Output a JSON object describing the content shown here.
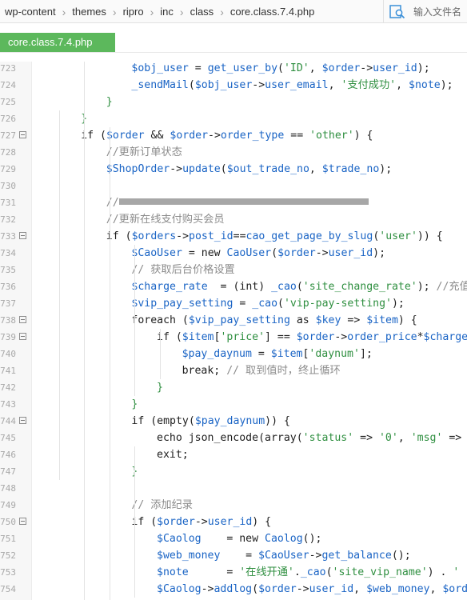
{
  "breadcrumb": [
    "wp-content",
    "themes",
    "ripro",
    "inc",
    "class",
    "core.class.7.4.php"
  ],
  "goto_file": {
    "placeholder": "输入文件名"
  },
  "tab": {
    "label": "core.class.7.4.php"
  },
  "colors": {
    "accent_tab": "#5cb85c",
    "variable": "#1a64c5",
    "function": "#1a64c5",
    "string": "#2f8f40",
    "comment": "#8c8c8c",
    "keyword": "#1e1e1e"
  },
  "code_lines": [
    {
      "num": "723",
      "indent": 4,
      "fold": false,
      "tokens": [
        [
          "v",
          "$obj_user"
        ],
        [
          "p",
          " = "
        ],
        [
          "f",
          "get_user_by"
        ],
        [
          "p",
          "("
        ],
        [
          "s",
          "'ID'"
        ],
        [
          "p",
          ", "
        ],
        [
          "v",
          "$order"
        ],
        [
          "p",
          "->"
        ],
        [
          "f",
          "user_id"
        ],
        [
          "p",
          ");"
        ]
      ]
    },
    {
      "num": "724",
      "indent": 4,
      "fold": false,
      "tokens": [
        [
          "f",
          "_sendMail"
        ],
        [
          "p",
          "("
        ],
        [
          "v",
          "$obj_user"
        ],
        [
          "p",
          "->"
        ],
        [
          "f",
          "user_email"
        ],
        [
          "p",
          ", "
        ],
        [
          "s",
          "'支付成功'"
        ],
        [
          "p",
          ", "
        ],
        [
          "v",
          "$note"
        ],
        [
          "p",
          ");"
        ]
      ]
    },
    {
      "num": "725",
      "indent": 3,
      "fold": false,
      "tokens": [
        [
          "g",
          "}"
        ]
      ]
    },
    {
      "num": "726",
      "indent": 2,
      "fold": false,
      "tokens": [
        [
          "g",
          "}"
        ]
      ]
    },
    {
      "num": "727",
      "indent": 2,
      "fold": true,
      "tokens": [
        [
          "k",
          "if"
        ],
        [
          "p",
          " ("
        ],
        [
          "v",
          "$order"
        ],
        [
          "p",
          " && "
        ],
        [
          "v",
          "$order"
        ],
        [
          "p",
          "->"
        ],
        [
          "f",
          "order_type"
        ],
        [
          "p",
          " == "
        ],
        [
          "s",
          "'other'"
        ],
        [
          "p",
          ") {"
        ]
      ]
    },
    {
      "num": "728",
      "indent": 3,
      "fold": false,
      "tokens": [
        [
          "c",
          "//更新订单状态"
        ]
      ]
    },
    {
      "num": "729",
      "indent": 3,
      "fold": false,
      "tokens": [
        [
          "v",
          "$ShopOrder"
        ],
        [
          "p",
          "->"
        ],
        [
          "f",
          "update"
        ],
        [
          "p",
          "("
        ],
        [
          "v",
          "$out_trade_no"
        ],
        [
          "p",
          ", "
        ],
        [
          "v",
          "$trade_no"
        ],
        [
          "p",
          ");"
        ]
      ]
    },
    {
      "num": "730",
      "indent": 0,
      "fold": false,
      "tokens": []
    },
    {
      "num": "731",
      "indent": 3,
      "fold": false,
      "tokens": [
        [
          "c",
          "//"
        ],
        [
          "r",
          ""
        ]
      ]
    },
    {
      "num": "732",
      "indent": 3,
      "fold": false,
      "tokens": [
        [
          "c",
          "//更新在线支付购买会员"
        ]
      ]
    },
    {
      "num": "733",
      "indent": 3,
      "fold": true,
      "tokens": [
        [
          "k",
          "if"
        ],
        [
          "p",
          " ("
        ],
        [
          "v",
          "$orders"
        ],
        [
          "p",
          "->"
        ],
        [
          "f",
          "post_id"
        ],
        [
          "p",
          "=="
        ],
        [
          "f",
          "cao_get_page_by_slug"
        ],
        [
          "p",
          "("
        ],
        [
          "s",
          "'user'"
        ],
        [
          "p",
          ")) {"
        ]
      ]
    },
    {
      "num": "734",
      "indent": 4,
      "fold": false,
      "tokens": [
        [
          "v",
          "$CaoUser"
        ],
        [
          "p",
          " = "
        ],
        [
          "k",
          "new"
        ],
        [
          "p",
          " "
        ],
        [
          "f",
          "CaoUser"
        ],
        [
          "p",
          "("
        ],
        [
          "v",
          "$order"
        ],
        [
          "p",
          "->"
        ],
        [
          "f",
          "user_id"
        ],
        [
          "p",
          ");"
        ]
      ]
    },
    {
      "num": "735",
      "indent": 4,
      "fold": false,
      "tokens": [
        [
          "c",
          "// 获取后台价格设置"
        ]
      ]
    },
    {
      "num": "736",
      "indent": 4,
      "fold": false,
      "tokens": [
        [
          "v",
          "$charge_rate"
        ],
        [
          "p",
          "  = "
        ],
        [
          "p",
          "(int) "
        ],
        [
          "f",
          "_cao"
        ],
        [
          "p",
          "("
        ],
        [
          "s",
          "'site_change_rate'"
        ],
        [
          "p",
          "); "
        ],
        [
          "c",
          "//充值比例"
        ]
      ]
    },
    {
      "num": "737",
      "indent": 4,
      "fold": false,
      "tokens": [
        [
          "v",
          "$vip_pay_setting"
        ],
        [
          "p",
          " = "
        ],
        [
          "f",
          "_cao"
        ],
        [
          "p",
          "("
        ],
        [
          "s",
          "'vip-pay-setting'"
        ],
        [
          "p",
          ");"
        ]
      ]
    },
    {
      "num": "738",
      "indent": 4,
      "fold": true,
      "tokens": [
        [
          "k",
          "foreach"
        ],
        [
          "p",
          " ("
        ],
        [
          "v",
          "$vip_pay_setting"
        ],
        [
          "p",
          " as "
        ],
        [
          "v",
          "$key"
        ],
        [
          "p",
          " => "
        ],
        [
          "v",
          "$item"
        ],
        [
          "p",
          ") {"
        ]
      ]
    },
    {
      "num": "739",
      "indent": 5,
      "fold": true,
      "tokens": [
        [
          "k",
          "if"
        ],
        [
          "p",
          " ("
        ],
        [
          "v",
          "$item"
        ],
        [
          "p",
          "["
        ],
        [
          "s",
          "'price'"
        ],
        [
          "p",
          "] == "
        ],
        [
          "v",
          "$order"
        ],
        [
          "p",
          "->"
        ],
        [
          "f",
          "order_price"
        ],
        [
          "p",
          "*"
        ],
        [
          "v",
          "$charge_rate"
        ],
        [
          "p",
          ") {"
        ]
      ]
    },
    {
      "num": "740",
      "indent": 6,
      "fold": false,
      "tokens": [
        [
          "v",
          "$pay_daynum"
        ],
        [
          "p",
          " = "
        ],
        [
          "v",
          "$item"
        ],
        [
          "p",
          "["
        ],
        [
          "s",
          "'daynum'"
        ],
        [
          "p",
          "];"
        ]
      ]
    },
    {
      "num": "741",
      "indent": 6,
      "fold": false,
      "tokens": [
        [
          "k",
          "break"
        ],
        [
          "p",
          "; "
        ],
        [
          "c",
          "// 取到值时，终止循环"
        ]
      ]
    },
    {
      "num": "742",
      "indent": 5,
      "fold": false,
      "tokens": [
        [
          "g",
          "}"
        ]
      ]
    },
    {
      "num": "743",
      "indent": 4,
      "fold": false,
      "tokens": [
        [
          "g",
          "}"
        ]
      ]
    },
    {
      "num": "744",
      "indent": 4,
      "fold": true,
      "tokens": [
        [
          "k",
          "if"
        ],
        [
          "p",
          " ("
        ],
        [
          "k",
          "empty"
        ],
        [
          "p",
          "("
        ],
        [
          "v",
          "$pay_daynum"
        ],
        [
          "p",
          ")) {"
        ]
      ]
    },
    {
      "num": "745",
      "indent": 5,
      "fold": false,
      "tokens": [
        [
          "k",
          "echo"
        ],
        [
          "p",
          " "
        ],
        [
          "k",
          "json_encode"
        ],
        [
          "p",
          "("
        ],
        [
          "k",
          "array"
        ],
        [
          "p",
          "("
        ],
        [
          "s",
          "'status'"
        ],
        [
          "p",
          " => "
        ],
        [
          "s",
          "'0'"
        ],
        [
          "p",
          ", "
        ],
        [
          "s",
          "'msg'"
        ],
        [
          "p",
          " => "
        ]
      ]
    },
    {
      "num": "746",
      "indent": 5,
      "fold": false,
      "tokens": [
        [
          "k",
          "exit"
        ],
        [
          "p",
          ";"
        ]
      ]
    },
    {
      "num": "747",
      "indent": 4,
      "fold": false,
      "tokens": [
        [
          "g",
          "}"
        ]
      ]
    },
    {
      "num": "748",
      "indent": 0,
      "fold": false,
      "tokens": []
    },
    {
      "num": "749",
      "indent": 4,
      "fold": false,
      "tokens": [
        [
          "c",
          "// 添加纪录"
        ]
      ]
    },
    {
      "num": "750",
      "indent": 4,
      "fold": true,
      "tokens": [
        [
          "k",
          "if"
        ],
        [
          "p",
          " ("
        ],
        [
          "v",
          "$order"
        ],
        [
          "p",
          "->"
        ],
        [
          "f",
          "user_id"
        ],
        [
          "p",
          ") {"
        ]
      ]
    },
    {
      "num": "751",
      "indent": 5,
      "fold": false,
      "tokens": [
        [
          "v",
          "$Caolog"
        ],
        [
          "p",
          "    = "
        ],
        [
          "k",
          "new"
        ],
        [
          "p",
          " "
        ],
        [
          "f",
          "Caolog"
        ],
        [
          "p",
          "();"
        ]
      ]
    },
    {
      "num": "752",
      "indent": 5,
      "fold": false,
      "tokens": [
        [
          "v",
          "$web_money"
        ],
        [
          "p",
          "    = "
        ],
        [
          "v",
          "$CaoUser"
        ],
        [
          "p",
          "->"
        ],
        [
          "f",
          "get_balance"
        ],
        [
          "p",
          "();"
        ]
      ]
    },
    {
      "num": "753",
      "indent": 5,
      "fold": false,
      "tokens": [
        [
          "v",
          "$note"
        ],
        [
          "p",
          "      = "
        ],
        [
          "s",
          "'在线开通'"
        ],
        [
          "p",
          "."
        ],
        [
          "f",
          "_cao"
        ],
        [
          "p",
          "("
        ],
        [
          "s",
          "'site_vip_name'"
        ],
        [
          "p",
          ") ."
        ],
        [
          "s",
          " '"
        ]
      ]
    },
    {
      "num": "754",
      "indent": 5,
      "fold": false,
      "tokens": [
        [
          "v",
          "$Caolog"
        ],
        [
          "p",
          "->"
        ],
        [
          "f",
          "addlog"
        ],
        [
          "p",
          "("
        ],
        [
          "v",
          "$order"
        ],
        [
          "p",
          "->"
        ],
        [
          "f",
          "user_id"
        ],
        [
          "p",
          ", "
        ],
        [
          "v",
          "$web_money"
        ],
        [
          "p",
          ", "
        ],
        [
          "v",
          "$order"
        ]
      ]
    }
  ]
}
